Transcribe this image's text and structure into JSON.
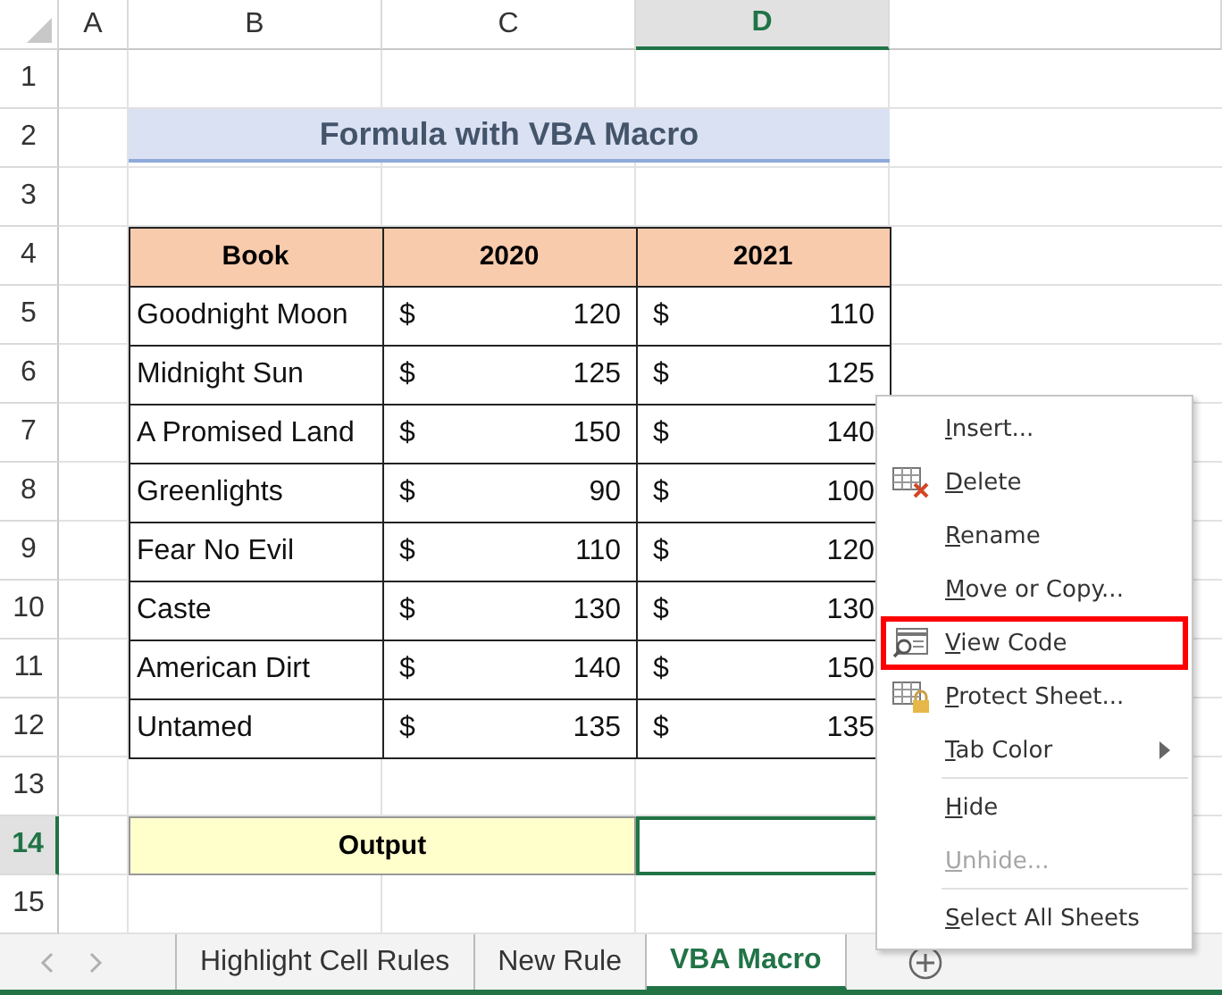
{
  "column_headers": [
    {
      "label": "A",
      "selected": false
    },
    {
      "label": "B",
      "selected": false
    },
    {
      "label": "C",
      "selected": false
    },
    {
      "label": "D",
      "selected": true
    }
  ],
  "row_headers": [
    {
      "label": "1",
      "selected": false
    },
    {
      "label": "2",
      "selected": false
    },
    {
      "label": "3",
      "selected": false
    },
    {
      "label": "4",
      "selected": false
    },
    {
      "label": "5",
      "selected": false
    },
    {
      "label": "6",
      "selected": false
    },
    {
      "label": "7",
      "selected": false
    },
    {
      "label": "8",
      "selected": false
    },
    {
      "label": "9",
      "selected": false
    },
    {
      "label": "10",
      "selected": false
    },
    {
      "label": "11",
      "selected": false
    },
    {
      "label": "12",
      "selected": false
    },
    {
      "label": "13",
      "selected": false
    },
    {
      "label": "14",
      "selected": true
    },
    {
      "label": "15",
      "selected": false
    }
  ],
  "title": "Formula with VBA Macro",
  "table": {
    "columns": [
      "Book",
      "2020",
      "2021"
    ],
    "rows": [
      {
        "book": "Goodnight Moon",
        "values": [
          {
            "currency": "$",
            "amount": "120"
          },
          {
            "currency": "$",
            "amount": "110"
          }
        ]
      },
      {
        "book": "Midnight Sun",
        "values": [
          {
            "currency": "$",
            "amount": "125"
          },
          {
            "currency": "$",
            "amount": "125"
          }
        ]
      },
      {
        "book": "A Promised Land",
        "values": [
          {
            "currency": "$",
            "amount": "150"
          },
          {
            "currency": "$",
            "amount": "140"
          }
        ]
      },
      {
        "book": "Greenlights",
        "values": [
          {
            "currency": "$",
            "amount": "90"
          },
          {
            "currency": "$",
            "amount": "100"
          }
        ]
      },
      {
        "book": "Fear No Evil",
        "values": [
          {
            "currency": "$",
            "amount": "110"
          },
          {
            "currency": "$",
            "amount": "120"
          }
        ]
      },
      {
        "book": "Caste",
        "values": [
          {
            "currency": "$",
            "amount": "130"
          },
          {
            "currency": "$",
            "amount": "130"
          }
        ]
      },
      {
        "book": "American Dirt",
        "values": [
          {
            "currency": "$",
            "amount": "140"
          },
          {
            "currency": "$",
            "amount": "150"
          }
        ]
      },
      {
        "book": "Untamed",
        "values": [
          {
            "currency": "$",
            "amount": "135"
          },
          {
            "currency": "$",
            "amount": "135"
          }
        ]
      }
    ]
  },
  "output": {
    "label": "Output",
    "value_selected": true
  },
  "context_menu": [
    {
      "key": "I",
      "rest": "nsert...",
      "kind": "plain",
      "disabled": false,
      "highlighted": false,
      "submenu": false,
      "separator_before": false
    },
    {
      "key": "D",
      "rest": "elete",
      "kind": "delete",
      "disabled": false,
      "highlighted": false,
      "submenu": false,
      "separator_before": false
    },
    {
      "key": "R",
      "rest": "ename",
      "kind": "plain",
      "disabled": false,
      "highlighted": false,
      "submenu": false,
      "separator_before": false
    },
    {
      "key": "M",
      "rest": "ove or Copy...",
      "kind": "plain",
      "disabled": false,
      "highlighted": false,
      "submenu": false,
      "separator_before": false
    },
    {
      "key": "V",
      "rest": "iew Code",
      "kind": "code",
      "disabled": false,
      "highlighted": true,
      "submenu": false,
      "separator_before": false
    },
    {
      "key": "P",
      "rest": "rotect Sheet...",
      "kind": "protect",
      "disabled": false,
      "highlighted": false,
      "submenu": false,
      "separator_before": false
    },
    {
      "key": "T",
      "rest": "ab Color",
      "kind": "plain",
      "disabled": false,
      "highlighted": false,
      "submenu": true,
      "separator_before": false
    },
    {
      "key": "H",
      "rest": "ide",
      "kind": "plain",
      "disabled": false,
      "highlighted": false,
      "submenu": false,
      "separator_before": true
    },
    {
      "key": "U",
      "rest": "nhide...",
      "kind": "plain",
      "disabled": true,
      "highlighted": false,
      "submenu": false,
      "separator_before": false
    },
    {
      "key": "S",
      "rest": "elect All Sheets",
      "kind": "plain",
      "disabled": false,
      "highlighted": false,
      "submenu": false,
      "separator_before": true
    }
  ],
  "sheet_tabs": [
    {
      "label": "Highlight Cell Rules",
      "selected": false
    },
    {
      "label": "New Rule",
      "selected": false
    },
    {
      "label": "VBA Macro",
      "selected": true
    }
  ]
}
